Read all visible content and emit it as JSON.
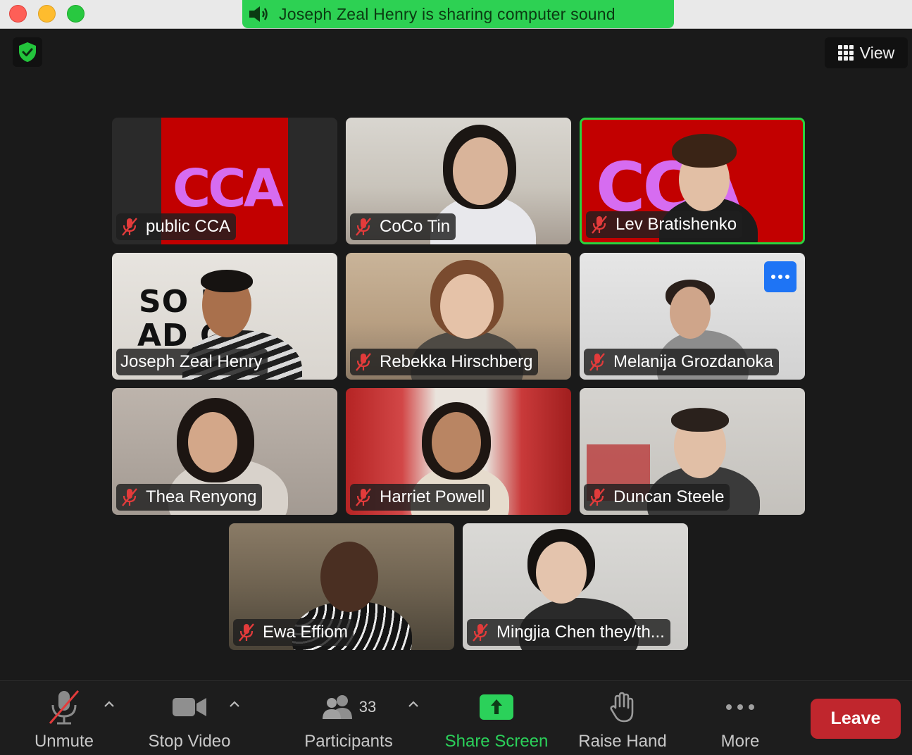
{
  "window": {
    "share_banner": "Joseph Zeal Henry is sharing computer sound"
  },
  "top": {
    "view_label": "View"
  },
  "participants": [
    {
      "name": "public CCA",
      "muted": true
    },
    {
      "name": "CoCo Tin",
      "muted": true
    },
    {
      "name": "Lev Bratishenko",
      "muted": true,
      "active_speaker": true
    },
    {
      "name": "Joseph Zeal Henry",
      "muted": false
    },
    {
      "name": "Rebekka Hirschberg",
      "muted": true
    },
    {
      "name": "Melanija Grozdanoka",
      "muted": true
    },
    {
      "name": "Thea Renyong",
      "muted": true
    },
    {
      "name": "Harriet Powell",
      "muted": true
    },
    {
      "name": "Duncan Steele",
      "muted": true
    },
    {
      "name": "Ewa Effiom",
      "muted": true
    },
    {
      "name": "Mingjia Chen they/th...",
      "muted": true
    }
  ],
  "tile_text": {
    "cca_logo": "CCA",
    "sound_line1": "SO ND",
    "sound_line2": "AD CE"
  },
  "toolbar": {
    "unmute": "Unmute",
    "stop_video": "Stop Video",
    "participants": "Participants",
    "participants_count": "33",
    "share_screen": "Share Screen",
    "raise_hand": "Raise Hand",
    "more": "More",
    "leave": "Leave"
  },
  "colors": {
    "share_banner": "#2dd153",
    "active_border": "#2ad33f",
    "leave": "#c0262d",
    "share_screen": "#2bd15a"
  }
}
